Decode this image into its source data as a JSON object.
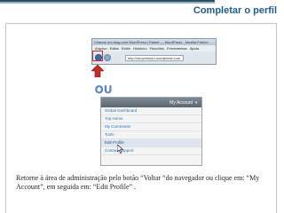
{
  "slide": {
    "title": "Completar o perfil",
    "or_label": "OU",
    "caption": "Retorne à área de administração pelo botão “Voltar “do navegador ou clique em: “My Account”, em seguida em: “Edit Profile” ."
  },
  "browser": {
    "window_title": "Criando um blog com WordPress | Painel — WordPress - Mozilla Firefox",
    "menu_items": [
      "Arquivo",
      "Editar",
      "Exibir",
      "Histórico",
      "Favoritos",
      "Ferramentas",
      "Ajuda"
    ],
    "url": "http://seuprimeiro.wordpress.com"
  },
  "account_menu": {
    "header_label": "My Account",
    "caret": "▼",
    "items": [
      "Global Dashboard",
      "Top Home",
      "My Comments",
      "Tools",
      "Edit Profile",
      "Contact Support"
    ],
    "active_index": 4
  },
  "colors": {
    "title": "#1f5c8a",
    "or_label": "#5a8bc9",
    "highlight": "#d12b2b",
    "menu_link": "#2f6fb0"
  }
}
